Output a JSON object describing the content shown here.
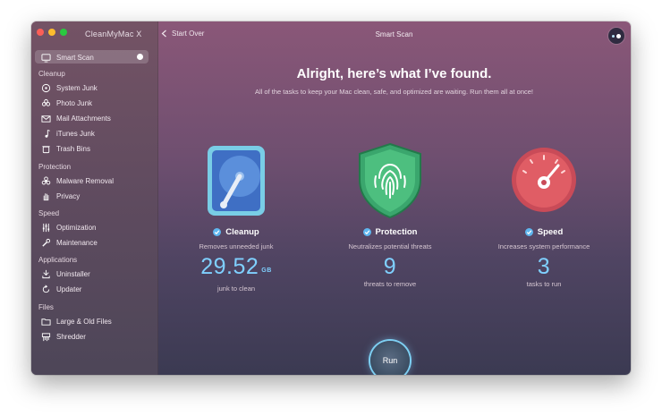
{
  "app": {
    "title": "CleanMyMac X"
  },
  "toolbar": {
    "back_label": "Start Over",
    "window_title": "Smart Scan"
  },
  "sidebar": {
    "active": {
      "label": "Smart Scan"
    },
    "sections": [
      {
        "title": "Cleanup",
        "items": [
          {
            "label": "System Junk",
            "icon": "disk-icon"
          },
          {
            "label": "Photo Junk",
            "icon": "flower-icon"
          },
          {
            "label": "Mail Attachments",
            "icon": "mail-icon"
          },
          {
            "label": "iTunes Junk",
            "icon": "music-note-icon"
          },
          {
            "label": "Trash Bins",
            "icon": "trash-icon"
          }
        ]
      },
      {
        "title": "Protection",
        "items": [
          {
            "label": "Malware Removal",
            "icon": "biohazard-icon"
          },
          {
            "label": "Privacy",
            "icon": "hand-icon"
          }
        ]
      },
      {
        "title": "Speed",
        "items": [
          {
            "label": "Optimization",
            "icon": "sliders-icon"
          },
          {
            "label": "Maintenance",
            "icon": "wrench-icon"
          }
        ]
      },
      {
        "title": "Applications",
        "items": [
          {
            "label": "Uninstaller",
            "icon": "uninstaller-icon"
          },
          {
            "label": "Updater",
            "icon": "updater-icon"
          }
        ]
      },
      {
        "title": "Files",
        "items": [
          {
            "label": "Large & Old Files",
            "icon": "folder-icon"
          },
          {
            "label": "Shredder",
            "icon": "shredder-icon"
          }
        ]
      }
    ]
  },
  "main": {
    "headline": "Alright, here’s what I’ve found.",
    "subline": "All of the tasks to keep your Mac clean, safe, and optimized are waiting. Run them all at once!",
    "cards": [
      {
        "title": "Cleanup",
        "description": "Removes unneeded junk",
        "value": "29.52",
        "unit": "GB",
        "caption": "junk to clean"
      },
      {
        "title": "Protection",
        "description": "Neutralizes potential threats",
        "value": "9",
        "unit": "",
        "caption": "threats to remove"
      },
      {
        "title": "Speed",
        "description": "Increases system performance",
        "value": "3",
        "unit": "",
        "caption": "tasks to run"
      }
    ],
    "run_label": "Run"
  },
  "colors": {
    "accent": "#7fd0ff",
    "run_ring": "#7dcff2",
    "check": "#5fb6ef"
  }
}
